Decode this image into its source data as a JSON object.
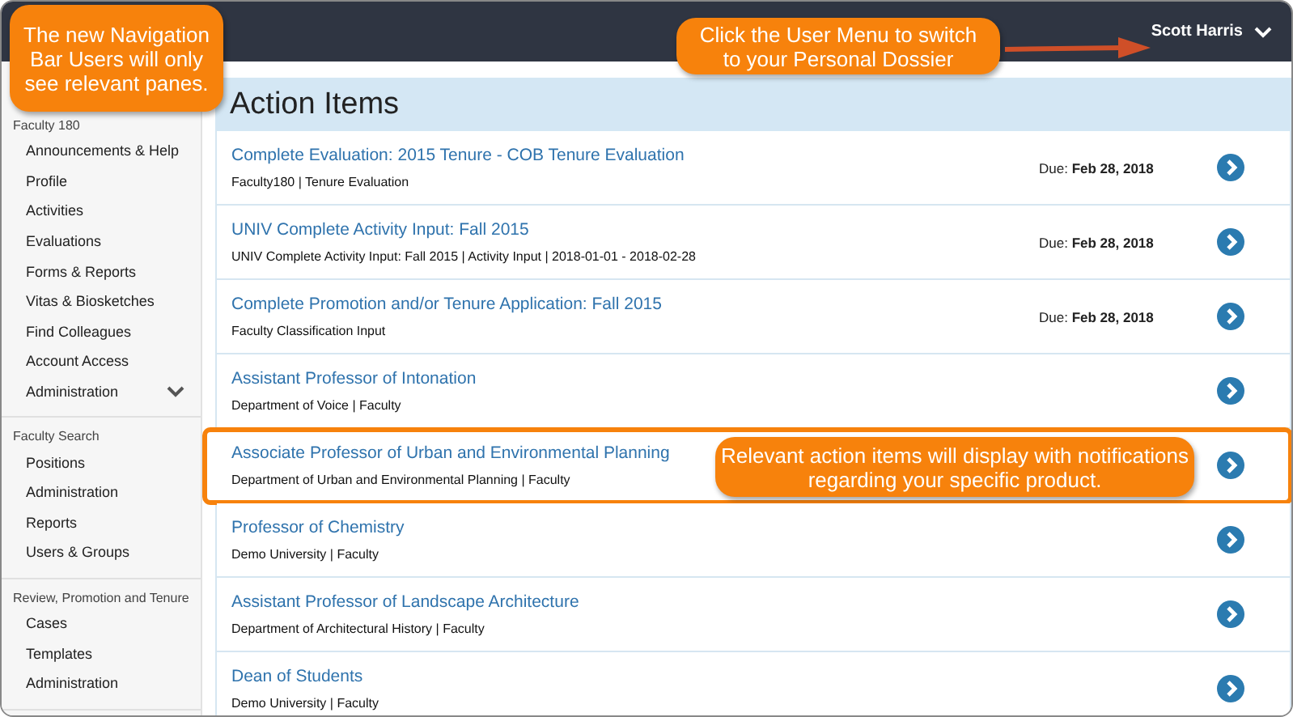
{
  "top_bar": {
    "user_menu": {
      "name": "Scott Harris",
      "callout": "Click the User Menu to switch to your Personal Dossier"
    }
  },
  "sidebar": {
    "callout": "The new Navigation Bar Users will only see relevant panes.",
    "sections": [
      {
        "heading": "Faculty 180",
        "items": [
          {
            "label": "Announcements & Help",
            "kind": "link"
          },
          {
            "label": "Profile",
            "kind": "link"
          },
          {
            "label": "Activities",
            "kind": "link"
          },
          {
            "label": "Evaluations",
            "kind": "link"
          },
          {
            "label": "Forms & Reports",
            "kind": "link"
          },
          {
            "label": "Vitas & Biosketches",
            "kind": "link"
          },
          {
            "label": "Find Colleagues",
            "kind": "link"
          },
          {
            "label": "Account Access",
            "kind": "link"
          },
          {
            "label": "Administration",
            "kind": "menu"
          }
        ]
      },
      {
        "heading": "Faculty Search",
        "items": [
          {
            "label": "Positions",
            "kind": "link"
          },
          {
            "label": "Administration",
            "kind": "link"
          },
          {
            "label": "Reports",
            "kind": "link"
          },
          {
            "label": "Users & Groups",
            "kind": "link"
          }
        ]
      },
      {
        "heading": "Review, Promotion and Tenure",
        "items": [
          {
            "label": "Cases",
            "kind": "link"
          },
          {
            "label": "Templates",
            "kind": "link"
          },
          {
            "label": "Administration",
            "kind": "link"
          }
        ]
      }
    ]
  },
  "action_items": {
    "title": "Action Items",
    "rows": [
      {
        "title": "Complete Evaluation: 2015 Tenure - COB Tenure Evaluation",
        "subtitle": "Faculty180 | Tenure Evaluation",
        "due": "Due: **Feb 28, 2018**",
        "highlighted": false
      },
      {
        "title": "UNIV Complete Activity Input: Fall 2015",
        "subtitle": "UNIV Complete Activity Input: Fall 2015 | Activity Input | 2018-01-01 - 2018-02-28",
        "due": "Due: **Feb 28, 2018**",
        "highlighted": false
      },
      {
        "title": "Complete Promotion and/or Tenure Application: Fall 2015",
        "subtitle": "Faculty Classification Input",
        "due": "Due: **Feb 28, 2018**",
        "highlighted": false
      },
      {
        "title": "Assistant Professor of Intonation",
        "subtitle": "Department of Voice | Faculty",
        "highlighted": false
      },
      {
        "title": "Associate Professor of Urban and Environmental Planning",
        "subtitle": "Department of Urban and Environmental Planning | Faculty",
        "highlighted": true,
        "callout": "Relevant action items will display with notifications regarding your specific product."
      },
      {
        "title": "Professor of Chemistry",
        "subtitle": "Demo University | Faculty",
        "highlighted": false
      },
      {
        "title": "Assistant Professor of Landscape Architecture",
        "subtitle": "Department of Architectural History | Faculty",
        "highlighted": false
      },
      {
        "title": "Dean of Students",
        "subtitle": "Demo University | Faculty",
        "highlighted": false
      }
    ]
  }
}
